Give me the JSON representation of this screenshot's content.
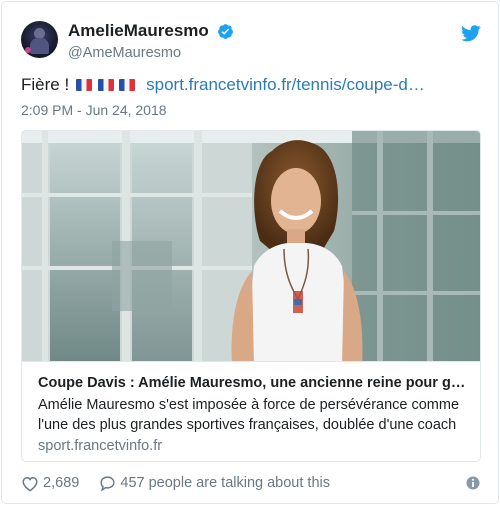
{
  "header": {
    "display_name": "AmelieMauresmo",
    "handle": "@AmeMauresmo",
    "verified_icon": "verified-badge-icon",
    "twitter_icon": "twitter-bird-icon"
  },
  "tweet": {
    "text": "Fière !",
    "flag_icon": "french-flag-icon",
    "flag_count": 3,
    "link_text": "sport.francetvinfo.fr/tennis/coupe-d…",
    "timestamp": "2:09 PM - Jun 24, 2018"
  },
  "card": {
    "image_name": "photo-amelie-mauresmo",
    "title": "Coupe Davis : Amélie Mauresmo, une ancienne reine pour gu…",
    "description": "Amélie Mauresmo s'est imposée à force de persévérance comme l'une des plus grandes sportives françaises, doublée d'une coach",
    "domain": "sport.francetvinfo.fr"
  },
  "actions": {
    "like_count": "2,689",
    "talking_text": "457 people are talking about this"
  },
  "colors": {
    "link": "#2b7bb9",
    "verified": "#1da1f2",
    "twitter_blue": "#1da1f2",
    "secondary_text": "#697882",
    "border": "#e1e8ed"
  }
}
